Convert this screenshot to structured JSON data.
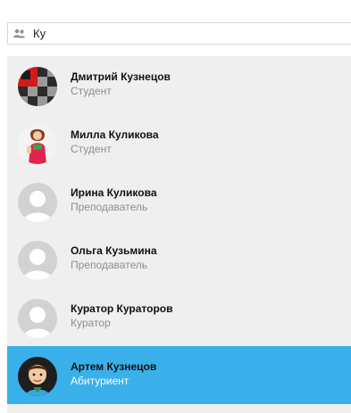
{
  "search": {
    "value": "Ку",
    "icon": "users-icon"
  },
  "contacts": [
    {
      "name": "Дмитрий Кузнецов",
      "role": "Студент",
      "avatar": "checkered-avatar"
    },
    {
      "name": "Милла Куликова",
      "role": "Студент",
      "avatar": "photo-avatar"
    },
    {
      "name": "Ирина Куликова",
      "role": "Преподаватель",
      "avatar": "default-avatar"
    },
    {
      "name": "Ольга Кузьмина",
      "role": "Преподаватель",
      "avatar": "default-avatar"
    },
    {
      "name": "Куратор Кураторов",
      "role": "Куратор",
      "avatar": "default-avatar"
    },
    {
      "name": "Артем Кузнецов",
      "role": "Абитуриент",
      "avatar": "cartoon-avatar",
      "selected": true
    }
  ],
  "colors": {
    "list_bg": "#efefef",
    "selected_bg": "#3ab0ea",
    "role_text": "#8e8e8e"
  }
}
